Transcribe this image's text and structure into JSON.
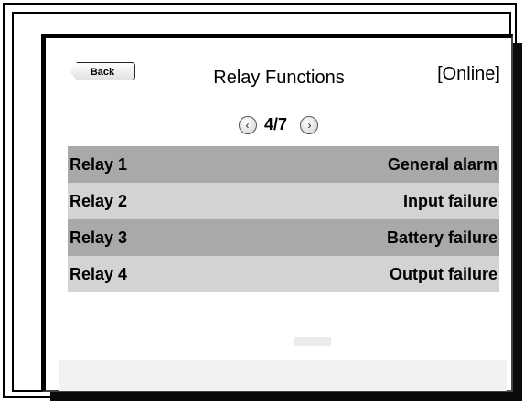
{
  "header": {
    "back_label": "Back",
    "title": "Relay Functions",
    "status": "[Online]"
  },
  "pager": {
    "prev_icon": "chevron-left-icon",
    "next_icon": "chevron-right-icon",
    "prev_glyph": "‹",
    "next_glyph": "›",
    "page_text": "4/7"
  },
  "relays": [
    {
      "name": "Relay  1",
      "function": "General alarm"
    },
    {
      "name": "Relay  2",
      "function": "Input failure"
    },
    {
      "name": "Relay  3",
      "function": "Battery failure"
    },
    {
      "name": "Relay  4",
      "function": "Output failure"
    }
  ],
  "colors": {
    "row_dark": "#a9a9a9",
    "row_light": "#d3d3d3"
  }
}
